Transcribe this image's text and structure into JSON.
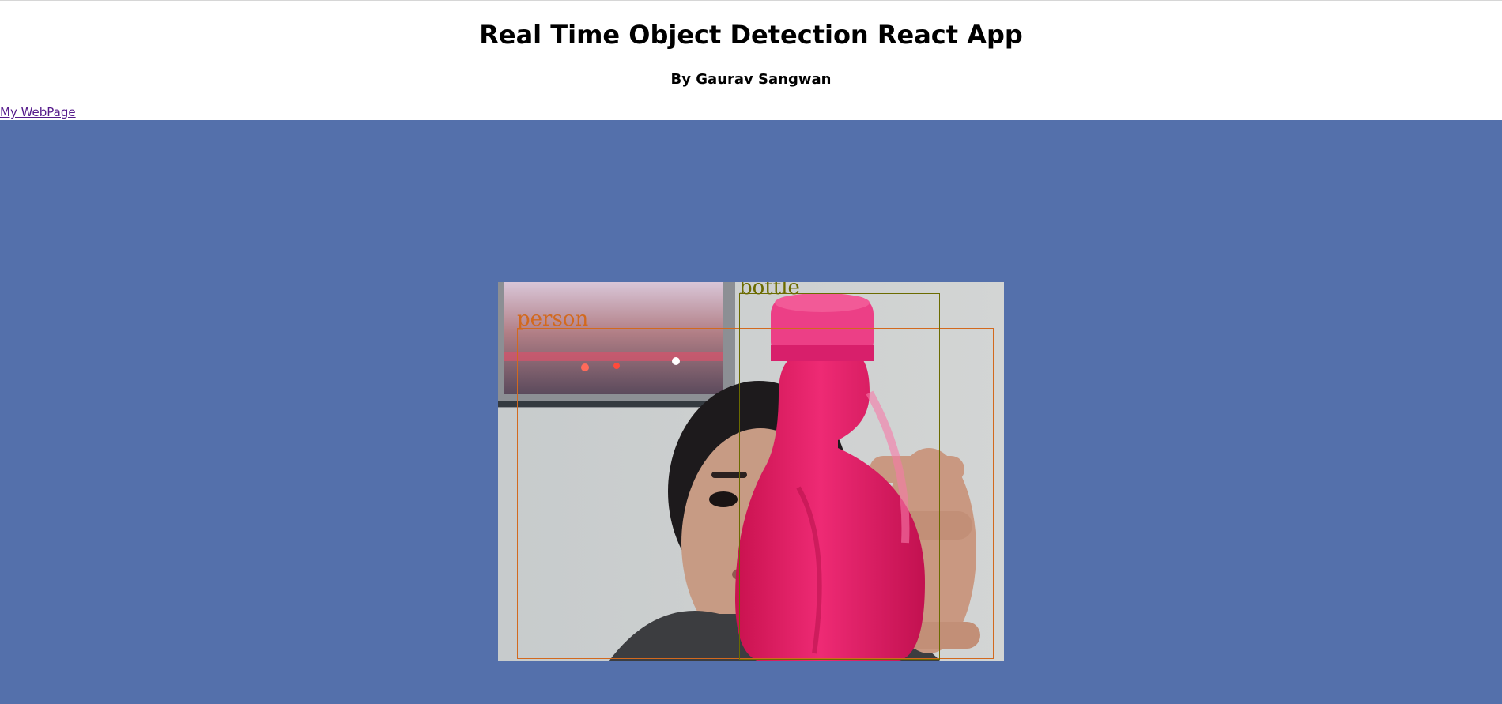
{
  "header": {
    "title": "Real Time Object Detection React App",
    "byline": "By Gaurav Sangwan",
    "link_text": "My WebPage"
  },
  "detections": [
    {
      "label": "person",
      "color": "#d2691e"
    },
    {
      "label": "bottle",
      "color": "#6b6b00"
    }
  ],
  "colors": {
    "page_background": "#5470ab",
    "header_background": "#ffffff",
    "link": "#551a8b",
    "bottle": "#e01d6a"
  }
}
